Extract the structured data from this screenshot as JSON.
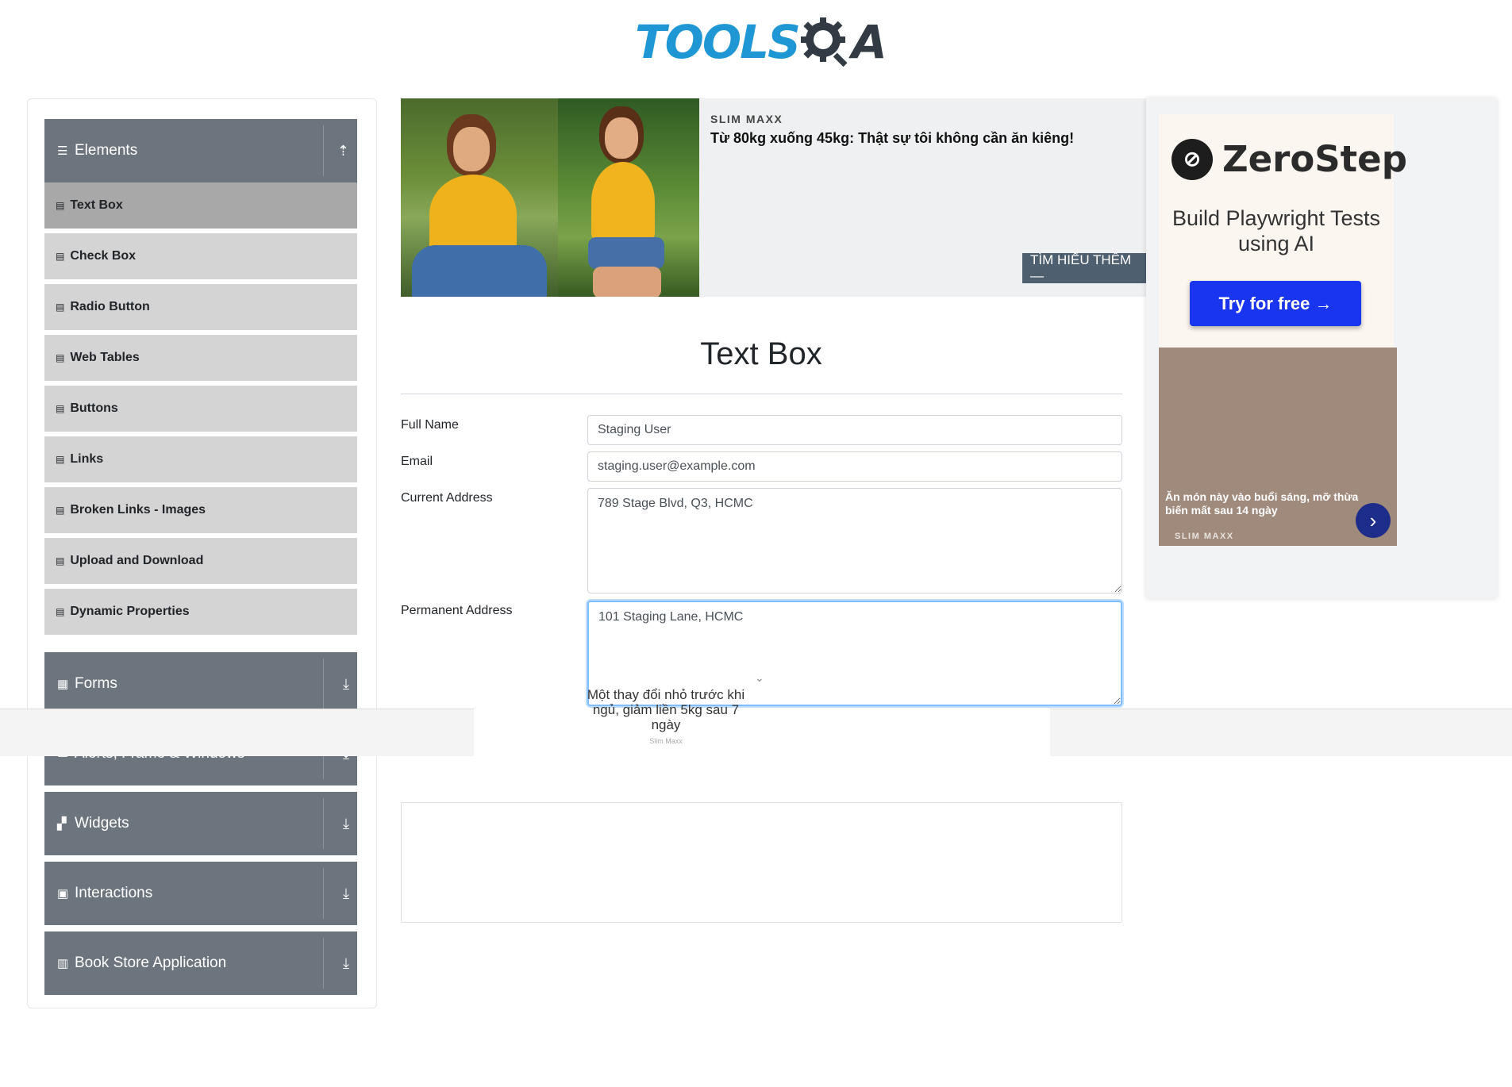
{
  "header": {
    "logo_tools": "TOOLS",
    "logo_qa": "A"
  },
  "sidebar": {
    "groups": [
      {
        "label": "Elements",
        "icon": "menu-icon",
        "arrow": "⇡"
      },
      {
        "label": "Forms",
        "icon": "form-icon",
        "arrow": "⤓"
      },
      {
        "label": "Alerts, Frame & Windows",
        "icon": "window-icon",
        "arrow": "⤓"
      },
      {
        "label": "Widgets",
        "icon": "widget-icon",
        "arrow": "⤓"
      },
      {
        "label": "Interactions",
        "icon": "interaction-icon",
        "arrow": "⤓"
      },
      {
        "label": "Book Store Application",
        "icon": "book-icon",
        "arrow": "⤓"
      }
    ],
    "items": [
      {
        "label": "Text Box"
      },
      {
        "label": "Check Box"
      },
      {
        "label": "Radio Button"
      },
      {
        "label": "Web Tables"
      },
      {
        "label": "Buttons"
      },
      {
        "label": "Links"
      },
      {
        "label": "Broken Links - Images"
      },
      {
        "label": "Upload and Download"
      },
      {
        "label": "Dynamic Properties"
      }
    ]
  },
  "top_ad": {
    "brand": "SLIM MAXX",
    "headline": "Từ 80kg xuống 45kg: Thật sự tôi không cần ăn kiêng!",
    "cta": "TÌM HIỂU THÊM —"
  },
  "right_ad": {
    "brand_name": "ZeroStep",
    "tagline": "Build Playwright Tests using AI",
    "button": "Try for free →",
    "lower_text": "Ăn món này vào buổi sáng, mỡ thừa biến mất sau 14 ngày",
    "lower_brand": "SLIM MAXX",
    "next_glyph": "›"
  },
  "main": {
    "title": "Text Box",
    "full_name_label": "Full Name",
    "full_name_value": "Staging User",
    "email_label": "Email",
    "email_value": "staging.user@example.com",
    "current_address_label": "Current Address",
    "current_address_value": "789 Stage Blvd, Q3, HCMC",
    "permanent_address_label": "Permanent Address",
    "permanent_address_value": "101 Staging Lane, HCMC"
  },
  "bottom_ad": {
    "text": "Một thay đổi nhỏ trước khi ngủ, giảm liền 5kg sau 7 ngày",
    "brand": "Slim Maxx",
    "chevron": "⌄"
  },
  "colors": {
    "sidebar_group": "#6c757d",
    "sidebar_item": "#d4d4d4",
    "sidebar_item_active": "#a8a8a8",
    "logo_blue": "#1f97d4",
    "logo_dark": "#323b44",
    "cta_blue": "#1a35f0"
  }
}
